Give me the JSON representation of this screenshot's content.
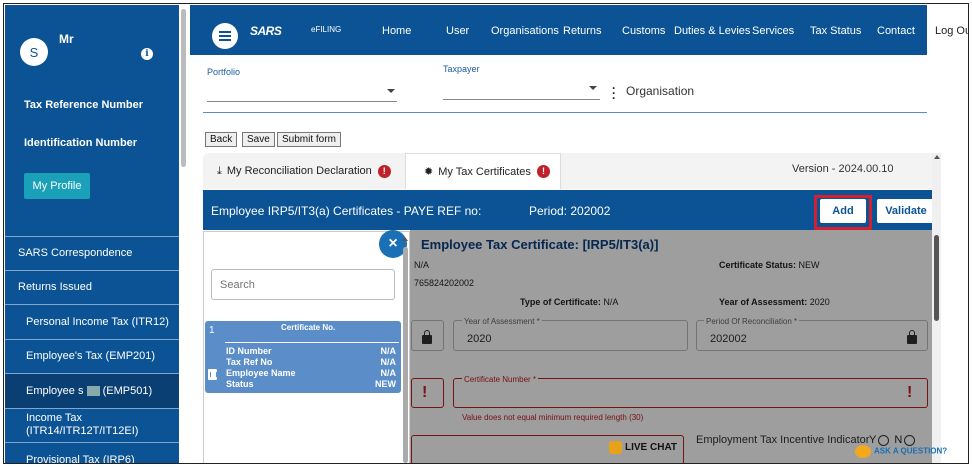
{
  "user": {
    "initial": "S",
    "name": "Mr"
  },
  "sidebar": {
    "tax_ref_label": "Tax Reference Number",
    "id_number_label": "Identification Number",
    "profile_button": "My Profile",
    "items": [
      {
        "label": "SARS Correspondence"
      },
      {
        "label": "Returns Issued"
      },
      {
        "label": "Personal Income Tax (ITR12)"
      },
      {
        "label": "Employee's Tax (EMP201)"
      },
      {
        "label_prefix": "Employee s",
        "label_suffix": "(EMP501)"
      },
      {
        "label": "Income Tax",
        "label2": "(ITR14/ITR12T/IT12EI)"
      },
      {
        "label": "Provisional Tax (IRP6)"
      }
    ]
  },
  "header": {
    "brand": "SARS",
    "filing": "eFILING",
    "nav": [
      "Home",
      "User",
      "Organisations",
      "Returns",
      "Customs",
      "Duties & Levies",
      "Services",
      "Tax Status",
      "Contact"
    ],
    "logout": "Log Out"
  },
  "selectors": {
    "portfolio_label": "Portfolio",
    "taxpayer_label": "Taxpayer",
    "organisation": "Organisation"
  },
  "actions": {
    "back": "Back",
    "save": "Save",
    "submit": "Submit form"
  },
  "tabs": [
    {
      "label": "My Reconciliation Declaration",
      "badge": "!"
    },
    {
      "label": "My Tax Certificates",
      "badge": "!"
    }
  ],
  "version": "Version - 2024.00.10",
  "cert_bar": {
    "title": "Employee IRP5/IT3(a) Certificates - PAYE REF no:",
    "period": "Period: 202002",
    "add": "Add",
    "validate": "Validate"
  },
  "certificate": {
    "heading": "Employee Tax Certificate: [IRP5/IT3(a)]",
    "line1": "N/A",
    "status_label": "Certificate Status:",
    "status": "NEW",
    "ref": "765824202002",
    "type_label": "Type of Certificate:",
    "type": "N/A",
    "year_label": "Year of Assessment:",
    "year": "2020",
    "field_year_label": "Year of Assessment *",
    "field_year_value": "2020",
    "field_period_label": "Period Of Reconciliation *",
    "field_period_value": "202002",
    "cert_number_label": "Certificate Number *",
    "error": "Value does not equal minimum required length (30)",
    "incentive_label": "Employment Tax Incentive Indicator",
    "yes": "Y",
    "no": "N"
  },
  "panel": {
    "close": "×",
    "search_placeholder": "Search",
    "card": {
      "index": "1",
      "header": "Certificate No.",
      "rows": [
        {
          "label": "ID Number",
          "value": "N/A"
        },
        {
          "label": "Tax Ref No",
          "value": "N/A"
        },
        {
          "label": "Employee Name",
          "value": "N/A"
        },
        {
          "label": "Status",
          "value": "NEW"
        }
      ]
    }
  },
  "chat": {
    "live": "LIVE CHAT",
    "ask": "ASK A QUESTION?"
  }
}
